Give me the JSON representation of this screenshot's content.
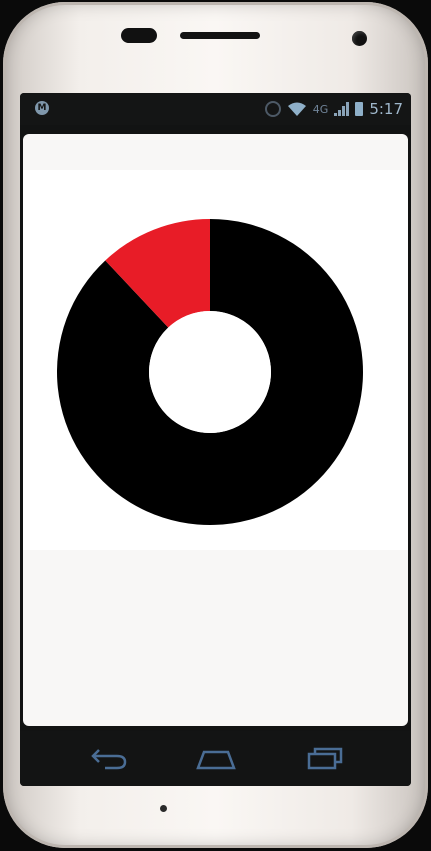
{
  "status_bar": {
    "network_label": "4G",
    "time": "5:17",
    "icons": [
      "motorola-logo-icon",
      "sync-icon",
      "wifi-icon",
      "signal-icon",
      "battery-icon"
    ]
  },
  "chart_data": {
    "type": "pie",
    "style": "donut",
    "title": "",
    "slices": [
      {
        "name": "",
        "value": 88,
        "color": "#000000"
      },
      {
        "name": "",
        "value": 12,
        "color": "#e81c27"
      }
    ]
  },
  "nav_bar": {
    "icons": [
      "back-icon",
      "home-icon",
      "recent-apps-icon"
    ]
  },
  "colors": {
    "status_icons": "#9fb7cb",
    "nav_icons": "#4a6d95",
    "highlight": "#e81c27"
  }
}
